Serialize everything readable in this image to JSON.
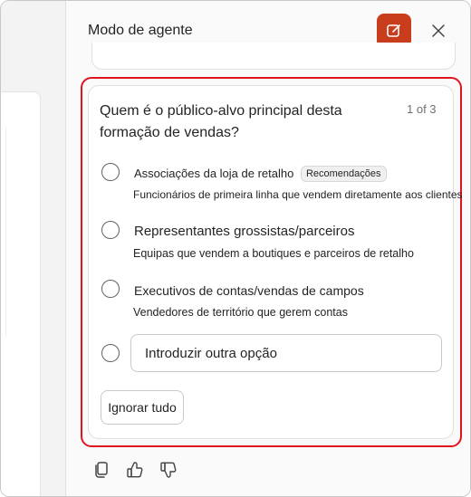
{
  "panel": {
    "title": "Modo de agente"
  },
  "question": {
    "text": "Quem é o público-alvo principal desta formação de vendas?",
    "counter": "1 of 3",
    "options": [
      {
        "title": "Associações da loja de retalho",
        "badge": "Recomendações",
        "description": "Funcionários de primeira linha que vendem diretamente aos clientes"
      },
      {
        "title": "Representantes grossistas/parceiros",
        "description": "Equipas que vendem a boutiques e parceiros de retalho"
      },
      {
        "title": "Executivos de contas/vendas de campos",
        "description": "Vendedores de território que gerem contas"
      }
    ],
    "other_placeholder": "Introduzir outra opção",
    "ignore_label": "Ignorar tudo"
  },
  "icons": {
    "new_chat": "compose-icon",
    "close": "close-icon",
    "copy": "copy-icon",
    "like": "thumbs-up-icon",
    "dislike": "thumbs-down-icon"
  },
  "colors": {
    "accent": "#c83d1c",
    "highlight": "#e0141e"
  }
}
